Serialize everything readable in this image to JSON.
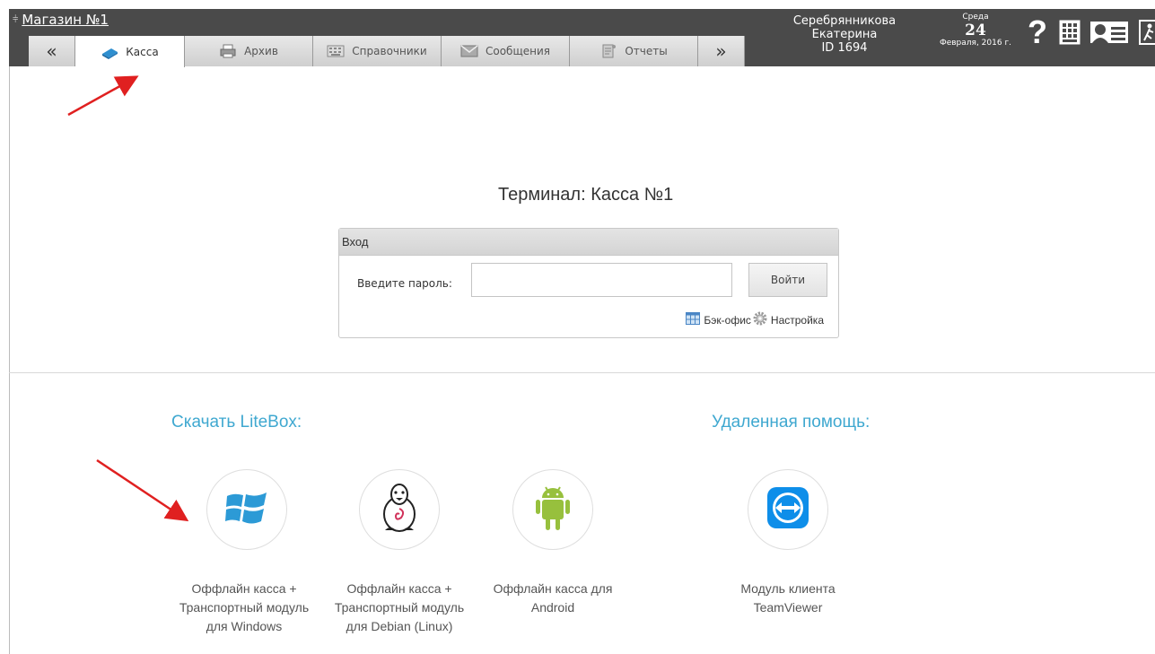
{
  "header": {
    "store_name": "Магазин №1",
    "tabs": [
      {
        "label": "Касса",
        "icon": "cash-register-icon",
        "active": true
      },
      {
        "label": "Архив",
        "icon": "printer-icon",
        "active": false
      },
      {
        "label": "Справочники",
        "icon": "keyboard-icon",
        "active": false
      },
      {
        "label": "Сообщения",
        "icon": "envelope-icon",
        "active": false
      },
      {
        "label": "Отчеты",
        "icon": "report-icon",
        "active": false
      }
    ],
    "nav_prev": "«",
    "nav_next": "»",
    "user_name": "Серебрянникова Екатерина",
    "user_id": "ID 1694",
    "date_dow": "Среда",
    "date_day": "24",
    "date_month": "Февраля, 2016 г.",
    "help_label": "?"
  },
  "terminal": {
    "title": "Терминал: Касса №1",
    "login_header": "Вход",
    "password_label": "Введите пароль:",
    "password_value": "",
    "login_button": "Войти",
    "backoffice_link": "Бэк-офис",
    "settings_link": "Настройка"
  },
  "downloads": {
    "title": "Скачать LiteBox:",
    "items": [
      {
        "icon": "windows-icon",
        "label_lines": [
          "Оффлайн касса +",
          "Транспортный модуль",
          "для Windows"
        ]
      },
      {
        "icon": "linux-penguin-icon",
        "label_lines": [
          "Оффлайн касса +",
          "Транспортный модуль",
          "для Debian (Linux)"
        ]
      },
      {
        "icon": "android-icon",
        "label_lines": [
          "Оффлайн касса для",
          "Android"
        ]
      }
    ]
  },
  "remote": {
    "title": "Удаленная помощь:",
    "items": [
      {
        "icon": "teamviewer-icon",
        "label_lines": [
          "Модуль клиента",
          "TeamViewer"
        ]
      }
    ]
  },
  "colors": {
    "topbar": "#4a4a4a",
    "accent": "#3fa8d0",
    "annotation_arrow": "#e02020"
  }
}
